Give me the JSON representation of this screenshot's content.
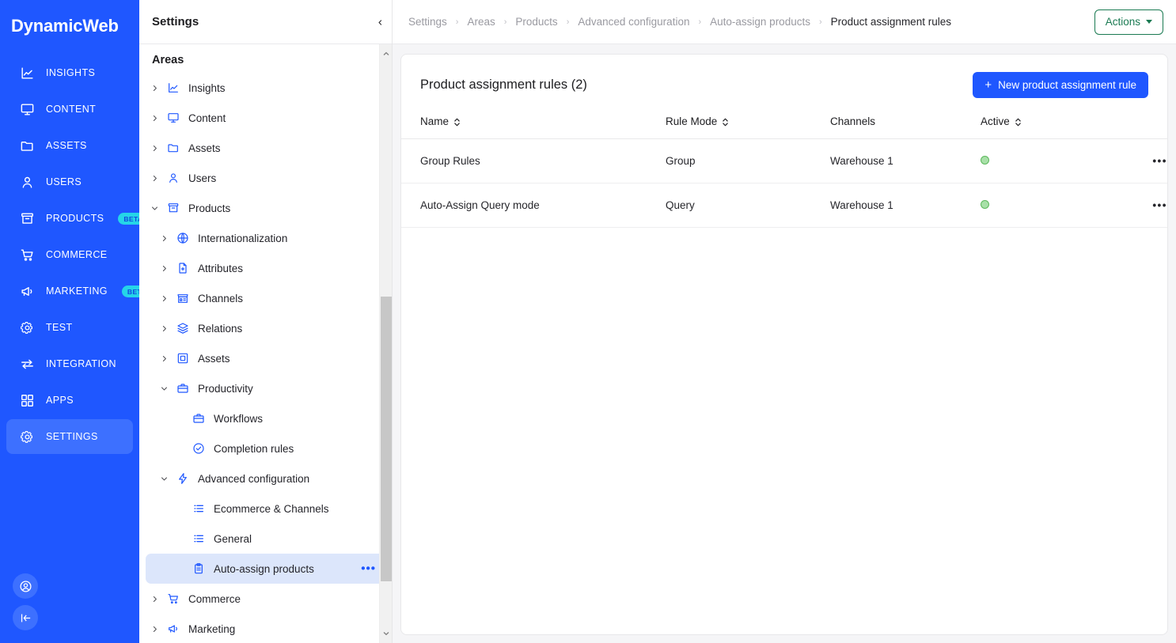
{
  "brand": {
    "name": "DynamicWeb"
  },
  "rail": {
    "items": [
      {
        "label": "INSIGHTS",
        "icon": "insights-icon",
        "badge": null,
        "active": false
      },
      {
        "label": "CONTENT",
        "icon": "monitor-icon",
        "badge": null,
        "active": false
      },
      {
        "label": "ASSETS",
        "icon": "folder-icon",
        "badge": null,
        "active": false
      },
      {
        "label": "USERS",
        "icon": "user-icon",
        "badge": null,
        "active": false
      },
      {
        "label": "PRODUCTS",
        "icon": "archive-icon",
        "badge": "BETA",
        "active": false
      },
      {
        "label": "COMMERCE",
        "icon": "cart-icon",
        "badge": null,
        "active": false
      },
      {
        "label": "MARKETING",
        "icon": "megaphone-icon",
        "badge": "BETA",
        "active": false
      },
      {
        "label": "TEST",
        "icon": "gear-icon",
        "badge": null,
        "active": false
      },
      {
        "label": "INTEGRATION",
        "icon": "exchange-icon",
        "badge": null,
        "active": false
      },
      {
        "label": "APPS",
        "icon": "grid-icon",
        "badge": null,
        "active": false
      },
      {
        "label": "SETTINGS",
        "icon": "gear-icon",
        "badge": null,
        "active": true
      }
    ],
    "bottom": [
      {
        "icon": "account-circle-icon",
        "name": "account-button"
      },
      {
        "icon": "collapse-left-icon",
        "name": "collapse-rail-button"
      }
    ],
    "colors": {
      "background": "#1f57ff",
      "active": "#3d70ff",
      "badge_bg": "#25d5e8",
      "badge_text": "#1145e0"
    }
  },
  "tree": {
    "title": "Settings",
    "section": "Areas",
    "nodes": [
      {
        "label": "Insights",
        "icon": "insights-icon",
        "level": 1,
        "caret": "right",
        "selected": false,
        "dots": false
      },
      {
        "label": "Content",
        "icon": "monitor-icon",
        "level": 1,
        "caret": "right",
        "selected": false,
        "dots": false
      },
      {
        "label": "Assets",
        "icon": "folder-icon",
        "level": 1,
        "caret": "right",
        "selected": false,
        "dots": false
      },
      {
        "label": "Users",
        "icon": "user-icon",
        "level": 1,
        "caret": "right",
        "selected": false,
        "dots": false
      },
      {
        "label": "Products",
        "icon": "archive-icon",
        "level": 1,
        "caret": "down",
        "selected": false,
        "dots": false
      },
      {
        "label": "Internationalization",
        "icon": "globe-icon",
        "level": 2,
        "caret": "right",
        "selected": false,
        "dots": false
      },
      {
        "label": "Attributes",
        "icon": "file-plus-icon",
        "level": 2,
        "caret": "right",
        "selected": false,
        "dots": false
      },
      {
        "label": "Channels",
        "icon": "store-icon",
        "level": 2,
        "caret": "right",
        "selected": false,
        "dots": false
      },
      {
        "label": "Relations",
        "icon": "layers-icon",
        "level": 2,
        "caret": "right",
        "selected": false,
        "dots": false
      },
      {
        "label": "Assets",
        "icon": "image-icon",
        "level": 2,
        "caret": "right",
        "selected": false,
        "dots": false
      },
      {
        "label": "Productivity",
        "icon": "briefcase-icon",
        "level": 2,
        "caret": "down",
        "selected": false,
        "dots": false
      },
      {
        "label": "Workflows",
        "icon": "briefcase-icon",
        "level": 3,
        "caret": "none",
        "selected": false,
        "dots": false
      },
      {
        "label": "Completion rules",
        "icon": "check-circle-icon",
        "level": 3,
        "caret": "none",
        "selected": false,
        "dots": false
      },
      {
        "label": "Advanced configuration",
        "icon": "lightning-icon",
        "level": 2,
        "caret": "down",
        "selected": false,
        "dots": false
      },
      {
        "label": "Ecommerce & Channels",
        "icon": "list-icon",
        "level": 3,
        "caret": "none",
        "selected": false,
        "dots": false
      },
      {
        "label": "General",
        "icon": "list-icon",
        "level": 3,
        "caret": "none",
        "selected": false,
        "dots": false
      },
      {
        "label": "Auto-assign products",
        "icon": "clipboard-icon",
        "level": 3,
        "caret": "none",
        "selected": true,
        "dots": true
      },
      {
        "label": "Commerce",
        "icon": "cart-icon",
        "level": 1,
        "caret": "right",
        "selected": false,
        "dots": false
      },
      {
        "label": "Marketing",
        "icon": "megaphone-icon",
        "level": 1,
        "caret": "right",
        "selected": false,
        "dots": false
      }
    ],
    "collapse_icon": "chevron-left-icon",
    "scrollbar": {
      "up_icon": "chevron-up-icon",
      "down_icon": "chevron-down-icon"
    }
  },
  "topbar": {
    "breadcrumbs": [
      {
        "label": "Settings",
        "current": false
      },
      {
        "label": "Areas",
        "current": false
      },
      {
        "label": "Products",
        "current": false
      },
      {
        "label": "Advanced configuration",
        "current": false
      },
      {
        "label": "Auto-assign products",
        "current": false
      },
      {
        "label": "Product assignment rules",
        "current": true
      }
    ],
    "separator": "›",
    "actions_label": "Actions",
    "actions_color": "#1a7a52"
  },
  "card": {
    "title": "Product assignment rules (2)",
    "new_button_label": "New product assignment rule",
    "new_button_icon": "plus-icon",
    "new_button_color": "#1f57ff",
    "columns": [
      {
        "label": "Name",
        "sortable": true
      },
      {
        "label": "Rule Mode",
        "sortable": true
      },
      {
        "label": "Channels",
        "sortable": false
      },
      {
        "label": "Active",
        "sortable": true
      }
    ],
    "rows": [
      {
        "name": "Group Rules",
        "rule_mode": "Group",
        "channels": "Warehouse 1",
        "active": true,
        "menu": "•••"
      },
      {
        "name": "Auto-Assign Query mode",
        "rule_mode": "Query",
        "channels": "Warehouse 1",
        "active": true,
        "menu": "•••"
      }
    ],
    "active_dot_color": "#a8e0a8",
    "active_dot_border": "#5cb85c"
  }
}
